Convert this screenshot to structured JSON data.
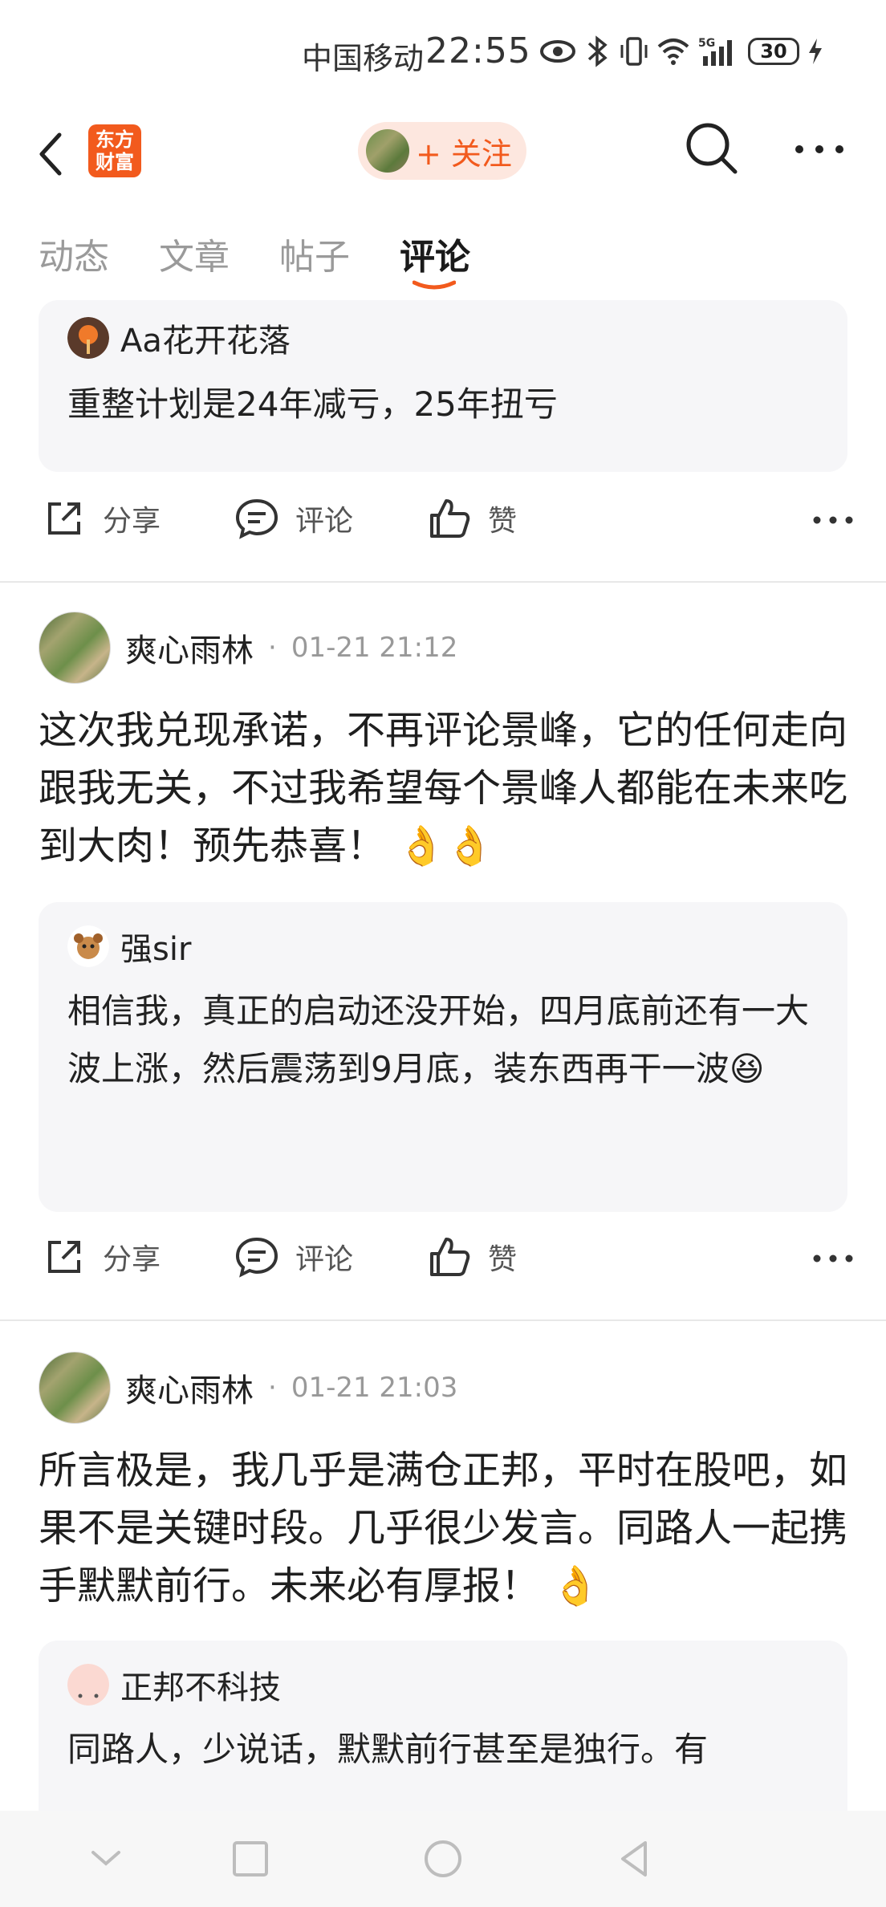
{
  "status_bar": {
    "carrier": "中国移动",
    "time": "22:55",
    "battery": "30",
    "signal_label": "5G"
  },
  "header": {
    "logo_line1": "东方",
    "logo_line2": "财富",
    "follow_label": "+ 关注"
  },
  "tabs": [
    {
      "label": "动态"
    },
    {
      "label": "文章"
    },
    {
      "label": "帖子"
    },
    {
      "label": "评论",
      "active": true
    }
  ],
  "actions": {
    "share": "分享",
    "comment": "评论",
    "like": "赞"
  },
  "feed": [
    {
      "quote": {
        "user": "Aa花开花落",
        "text": "重整计划是24年减亏，25年扭亏"
      }
    },
    {
      "user": "爽心雨林",
      "time": "01-21 21:12",
      "text": "这次我兑现承诺，不再评论景峰，它的任何走向跟我无关，不过我希望每个景峰人都能在未来吃到大肉！预先恭喜！ 👌👌",
      "quote": {
        "user": "强sir",
        "text": "相信我，真正的启动还没开始，四月底前还有一大波上涨，然后震荡到9月底，装东西再干一波😆"
      }
    },
    {
      "user": "爽心雨林",
      "time": "01-21 21:03",
      "text": "所言极是，我几乎是满仓正邦，平时在股吧，如果不是关键时段。几乎很少发言。同路人一起携手默默前行。未来必有厚报！ 👌",
      "quote": {
        "user": "正邦不科技",
        "text": "同路人，少说话，默默前行甚至是独行。有"
      }
    }
  ],
  "colors": {
    "accent": "#f25a1d",
    "follow_bg": "#fde7df",
    "quote_bg": "#f6f6f8"
  }
}
